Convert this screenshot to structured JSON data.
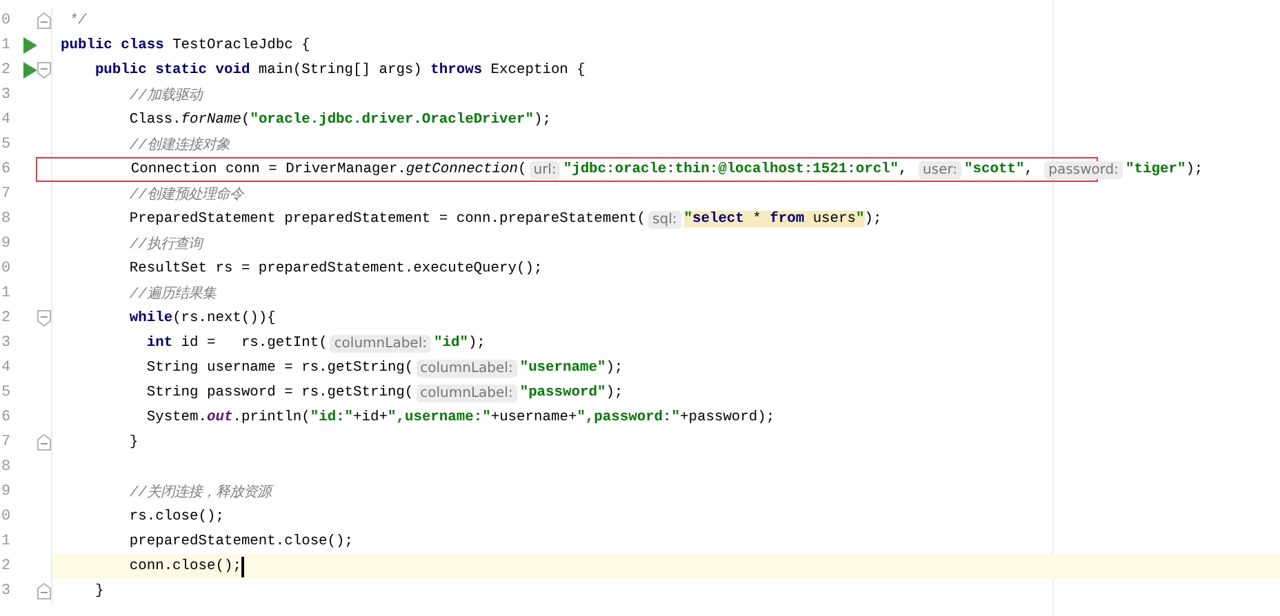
{
  "editor": {
    "lines": [
      {
        "number": "0",
        "fold_end": true,
        "tokens": [
          {
            "kind": "comment",
            "text": " */"
          }
        ]
      },
      {
        "number": "1",
        "run": true,
        "tokens": [
          {
            "kind": "keyword",
            "text": "public class"
          },
          {
            "kind": "plain",
            "text": " TestOracleJdbc {"
          }
        ]
      },
      {
        "number": "2",
        "run": true,
        "fold_start": true,
        "tokens": [
          {
            "kind": "keyword",
            "text": "    public static void"
          },
          {
            "kind": "plain",
            "text": " main(String[] args) "
          },
          {
            "kind": "keyword",
            "text": "throws"
          },
          {
            "kind": "plain",
            "text": " Exception {"
          }
        ]
      },
      {
        "number": "3",
        "tokens": [
          {
            "kind": "comment",
            "text": "        //加载驱动"
          }
        ]
      },
      {
        "number": "4",
        "tokens": [
          {
            "kind": "plain",
            "text": "        Class."
          },
          {
            "kind": "method",
            "text": "forName"
          },
          {
            "kind": "plain",
            "text": "("
          },
          {
            "kind": "string",
            "text": "\"oracle.jdbc.driver.OracleDriver\""
          },
          {
            "kind": "plain",
            "text": ");"
          }
        ]
      },
      {
        "number": "5",
        "tokens": [
          {
            "kind": "comment",
            "text": "        //创建连接对象"
          }
        ]
      },
      {
        "number": "6",
        "boxed": true,
        "tokens": [
          {
            "kind": "plain",
            "text": "        Connection conn = DriverManager."
          },
          {
            "kind": "method",
            "text": "getConnection"
          },
          {
            "kind": "plain",
            "text": "("
          },
          {
            "kind": "hint",
            "text": "url:"
          },
          {
            "kind": "string",
            "text": "\"jdbc:oracle:thin:@localhost:1521:orcl\""
          },
          {
            "kind": "plain",
            "text": ", "
          },
          {
            "kind": "hint",
            "text": "user:"
          },
          {
            "kind": "string",
            "text": "\"scott\""
          },
          {
            "kind": "plain",
            "text": ", "
          },
          {
            "kind": "hint",
            "text": "password:"
          },
          {
            "kind": "string",
            "text": "\"tiger\""
          },
          {
            "kind": "plain",
            "text": ");"
          }
        ]
      },
      {
        "number": "7",
        "tokens": [
          {
            "kind": "comment",
            "text": "        //创建预处理命令"
          }
        ]
      },
      {
        "number": "8",
        "tokens": [
          {
            "kind": "plain",
            "text": "        PreparedStatement preparedStatement = conn.prepareStatement("
          },
          {
            "kind": "hint",
            "text": "sql:"
          },
          {
            "kind": "sql-quote",
            "text": "\""
          },
          {
            "kind": "sql-keyword",
            "text": "select"
          },
          {
            "kind": "sql",
            "text": " * "
          },
          {
            "kind": "sql-keyword",
            "text": "from"
          },
          {
            "kind": "sql",
            "text": " users"
          },
          {
            "kind": "sql-quote",
            "text": "\""
          },
          {
            "kind": "plain",
            "text": ");"
          }
        ]
      },
      {
        "number": "9",
        "tokens": [
          {
            "kind": "comment",
            "text": "        //执行查询"
          }
        ]
      },
      {
        "number": "0",
        "tokens": [
          {
            "kind": "plain",
            "text": "        ResultSet rs = preparedStatement.executeQuery();"
          }
        ]
      },
      {
        "number": "1",
        "tokens": [
          {
            "kind": "comment",
            "text": "        //遍历结果集"
          }
        ]
      },
      {
        "number": "2",
        "fold_start": true,
        "tokens": [
          {
            "kind": "keyword",
            "text": "        while"
          },
          {
            "kind": "plain",
            "text": "(rs.next()){"
          }
        ]
      },
      {
        "number": "3",
        "tokens": [
          {
            "kind": "keyword",
            "text": "          int"
          },
          {
            "kind": "plain",
            "text": " id =   rs.getInt("
          },
          {
            "kind": "hint",
            "text": "columnLabel:"
          },
          {
            "kind": "string",
            "text": "\"id\""
          },
          {
            "kind": "plain",
            "text": ");"
          }
        ]
      },
      {
        "number": "4",
        "tokens": [
          {
            "kind": "plain",
            "text": "          String username = rs.getString("
          },
          {
            "kind": "hint",
            "text": "columnLabel:"
          },
          {
            "kind": "string",
            "text": "\"username\""
          },
          {
            "kind": "plain",
            "text": ");"
          }
        ]
      },
      {
        "number": "5",
        "tokens": [
          {
            "kind": "plain",
            "text": "          String password = rs.getString("
          },
          {
            "kind": "hint",
            "text": "columnLabel:"
          },
          {
            "kind": "string",
            "text": "\"password\""
          },
          {
            "kind": "plain",
            "text": ");"
          }
        ]
      },
      {
        "number": "6",
        "tokens": [
          {
            "kind": "plain",
            "text": "          System."
          },
          {
            "kind": "field",
            "text": "out"
          },
          {
            "kind": "plain",
            "text": ".println("
          },
          {
            "kind": "string",
            "text": "\"id:\""
          },
          {
            "kind": "plain",
            "text": "+id+"
          },
          {
            "kind": "string",
            "text": "\",username:\""
          },
          {
            "kind": "plain",
            "text": "+username+"
          },
          {
            "kind": "string",
            "text": "\",password:\""
          },
          {
            "kind": "plain",
            "text": "+password);"
          }
        ]
      },
      {
        "number": "7",
        "fold_end": true,
        "tokens": [
          {
            "kind": "plain",
            "text": "        }"
          }
        ]
      },
      {
        "number": "8"
      },
      {
        "number": "9",
        "tokens": [
          {
            "kind": "comment",
            "text": "        //关闭连接，释放资源"
          }
        ]
      },
      {
        "number": "0",
        "tokens": [
          {
            "kind": "plain",
            "text": "        rs.close();"
          }
        ]
      },
      {
        "number": "1",
        "tokens": [
          {
            "kind": "plain",
            "text": "        preparedStatement.close();"
          }
        ]
      },
      {
        "number": "2",
        "current": true,
        "tokens": [
          {
            "kind": "plain",
            "text": "        conn.close();"
          }
        ]
      },
      {
        "number": "3",
        "fold_end": true,
        "tokens": [
          {
            "kind": "plain",
            "text": "    }"
          }
        ]
      }
    ]
  }
}
